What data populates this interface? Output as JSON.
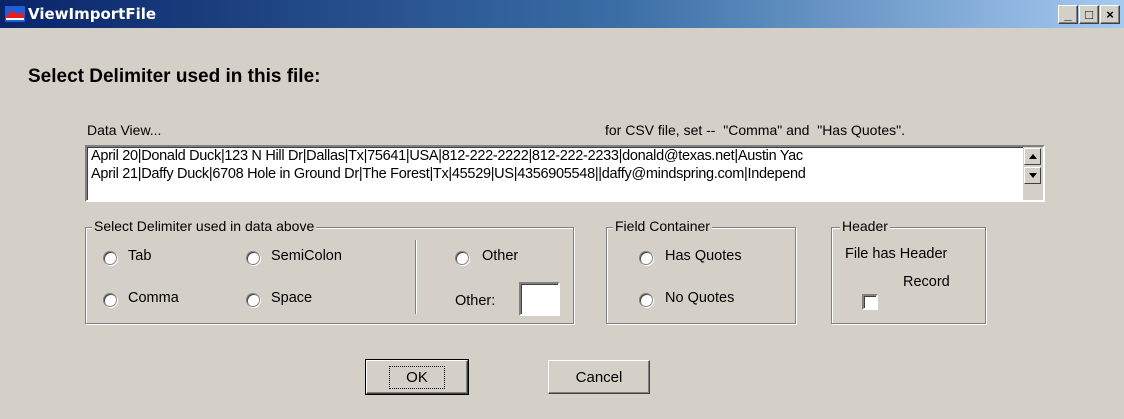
{
  "window": {
    "title": "ViewImportFile",
    "controls": {
      "minimize": "_",
      "maximize": "□",
      "close": "×"
    }
  },
  "heading": "Select Delimiter used in this file:",
  "data_view": {
    "label": "Data View...",
    "hint": "for CSV file, set --  \"Comma\" and  \"Has Quotes\".",
    "lines": [
      "April 20|Donald Duck|123 N Hill Dr|Dallas|Tx|75641|USA|812-222-2222|812-222-2233|donald@texas.net|Austin Yac",
      "April 21|Daffy Duck|6708 Hole in Ground Dr|The Forest|Tx|45529|US|4356905548||daffy@mindspring.com|Independ"
    ]
  },
  "delimiter_group": {
    "label": "Select Delimiter used in data above",
    "options": {
      "tab": "Tab",
      "semicolon": "SemiColon",
      "other": "Other",
      "comma": "Comma",
      "space": "Space"
    },
    "other_label": "Other:",
    "other_value": ""
  },
  "field_container": {
    "label": "Field Container",
    "options": {
      "has_quotes": "Has Quotes",
      "no_quotes": "No Quotes"
    }
  },
  "header_group": {
    "label": "Header",
    "text_line1": "File has Header",
    "text_line2": "Record",
    "checked": false
  },
  "buttons": {
    "ok": "OK",
    "cancel": "Cancel"
  }
}
